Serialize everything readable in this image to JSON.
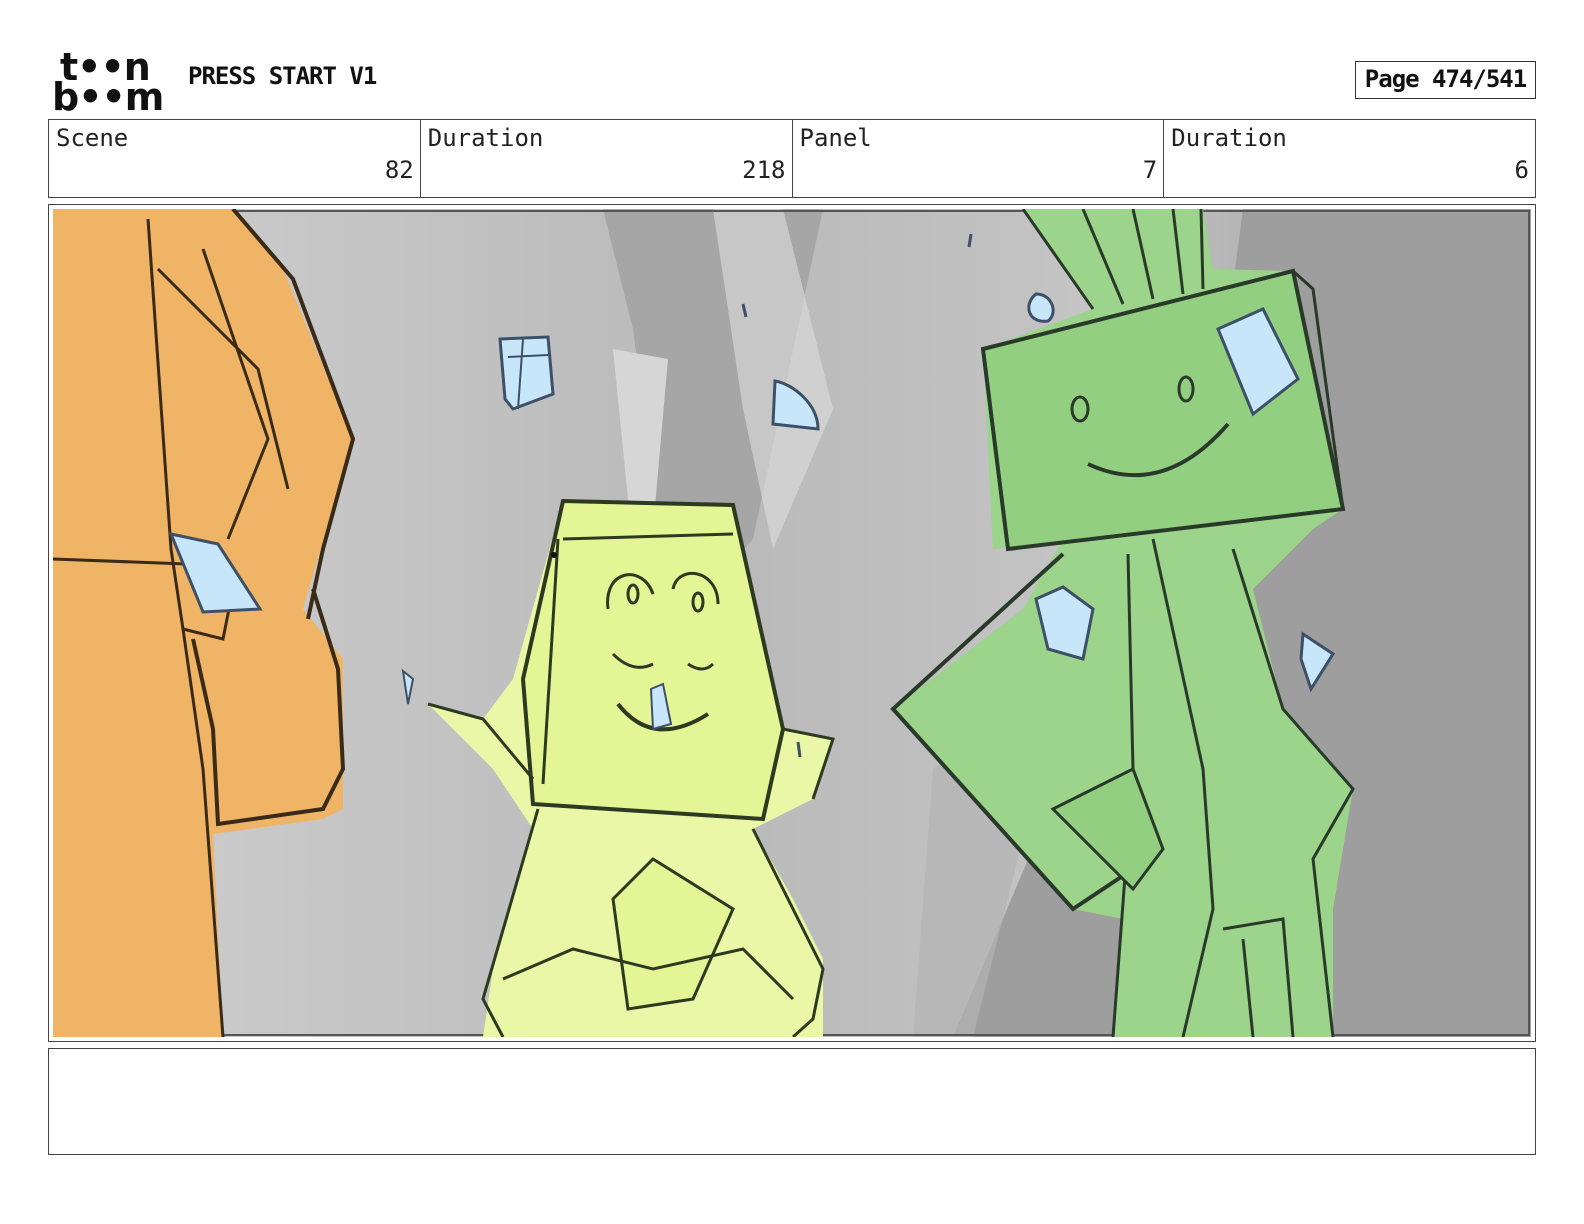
{
  "header": {
    "logo_line1": "t••n",
    "logo_line2": "b••m",
    "logo_name": "toon boom",
    "title": "PRESS START V1",
    "page_label": "Page 474/541"
  },
  "info": {
    "scene_label": "Scene",
    "scene_value": "82",
    "scene_duration_label": "Duration",
    "scene_duration_value": "218",
    "panel_label": "Panel",
    "panel_value": "7",
    "panel_duration_label": "Duration",
    "panel_duration_value": "6"
  },
  "notes": {
    "text": ""
  },
  "colors": {
    "orange_character": "#f0b466",
    "yellow_character": "#eaf7a6",
    "green_character": "#9bd48a",
    "confetti": "#c8e6fa",
    "outline": "#2a3a2a",
    "background_light": "#c8c8c8",
    "background_dark": "#9c9c9c"
  }
}
